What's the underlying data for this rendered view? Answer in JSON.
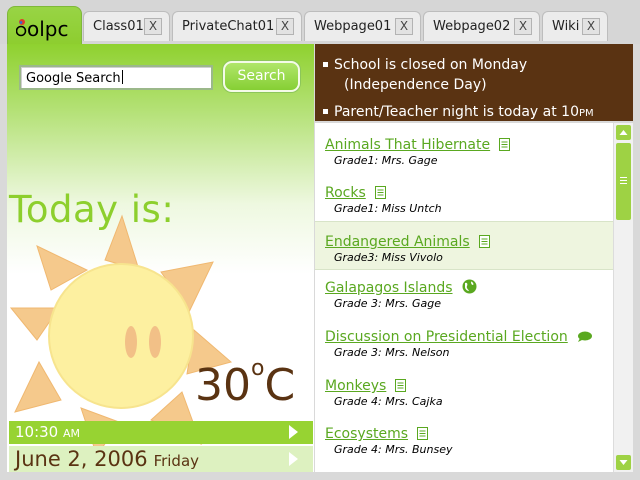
{
  "logo_text": "olpc",
  "tabs": [
    {
      "label": "Class01",
      "close": "X"
    },
    {
      "label": "PrivateChat01",
      "close": "X"
    },
    {
      "label": "Webpage01",
      "close": "X"
    },
    {
      "label": "Webpage02",
      "close": "X"
    },
    {
      "label": "Wiki",
      "close": "X"
    }
  ],
  "search": {
    "value": "Google Search",
    "button_label": "Search"
  },
  "today_label": "Today is:",
  "weather": {
    "icon": "sun-icon",
    "temp_value": "30",
    "temp_degree": "o",
    "temp_unit": "C"
  },
  "time": {
    "value": "10:30",
    "ampm": "AM"
  },
  "date": {
    "value": "June 2, 2006",
    "weekday": "Friday"
  },
  "announcements": [
    {
      "line1": "School is closed on Monday",
      "line2": "(Independence Day)"
    },
    {
      "text": "Parent/Teacher night is today at 10",
      "suffix": "PM"
    }
  ],
  "items": [
    {
      "title": "Animals That Hibernate",
      "subtitle": "Grade1: Mrs. Gage",
      "icon": "document-icon"
    },
    {
      "title": "Rocks",
      "subtitle": "Grade1: Miss Untch",
      "icon": "document-icon"
    },
    {
      "title": "Endangered Animals",
      "subtitle": "Grade3: Miss Vivolo",
      "icon": "document-icon"
    },
    {
      "title": "Galapagos Islands",
      "subtitle": "Grade 3: Mrs. Gage",
      "icon": "globe-icon"
    },
    {
      "title": "Discussion on Presidential Election",
      "subtitle": "Grade 3: Mrs. Nelson",
      "icon": "chat-bubble-icon"
    },
    {
      "title": "Monkeys",
      "subtitle": "Grade 4: Mrs. Cajka",
      "icon": "document-icon"
    },
    {
      "title": "Ecosystems",
      "subtitle": "Grade 4: Mrs. Bunsey",
      "icon": "document-icon"
    }
  ],
  "colors": {
    "accent_green": "#8dcf2d",
    "brown": "#5a3312",
    "link_green": "#5aa820",
    "highlight_row": "#eef5df"
  }
}
